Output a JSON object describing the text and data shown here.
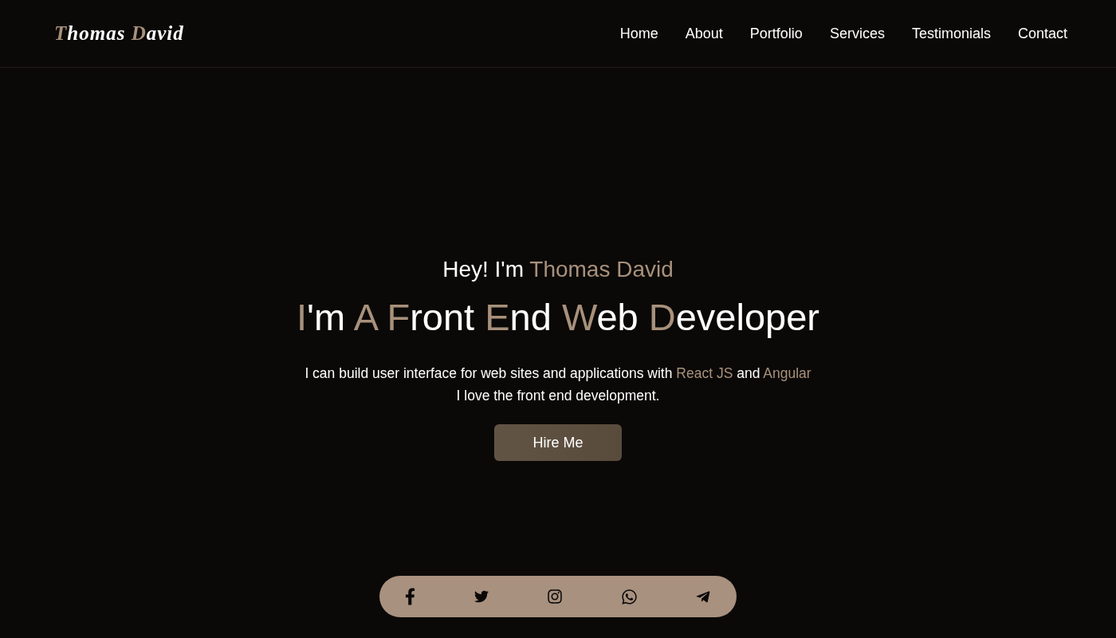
{
  "logo": {
    "segments": [
      {
        "text": "T",
        "accent": true
      },
      {
        "text": "homas ",
        "accent": false
      },
      {
        "text": "D",
        "accent": true
      },
      {
        "text": "avid",
        "accent": false
      }
    ]
  },
  "nav": {
    "items": [
      {
        "label": "Home"
      },
      {
        "label": "About"
      },
      {
        "label": "Portfolio"
      },
      {
        "label": "Services"
      },
      {
        "label": "Testimonials"
      },
      {
        "label": "Contact"
      }
    ]
  },
  "hero": {
    "greeting": {
      "segments": [
        {
          "text": "Hey! I'm ",
          "accent": false
        },
        {
          "text": "Thomas David",
          "accent": true
        }
      ]
    },
    "headline": {
      "segments": [
        {
          "text": "I",
          "accent": true
        },
        {
          "text": "'m ",
          "accent": false
        },
        {
          "text": "A ",
          "accent": true
        },
        {
          "text": "F",
          "accent": true
        },
        {
          "text": "ront ",
          "accent": false
        },
        {
          "text": "E",
          "accent": true
        },
        {
          "text": "nd ",
          "accent": false
        },
        {
          "text": "W",
          "accent": true
        },
        {
          "text": "eb ",
          "accent": false
        },
        {
          "text": "D",
          "accent": true
        },
        {
          "text": "eveloper",
          "accent": false
        }
      ]
    },
    "intro": {
      "lines": [
        {
          "segments": [
            {
              "text": "I can build user interface for web sites and applications with ",
              "accent": false
            },
            {
              "text": "React JS",
              "accent": true
            },
            {
              "text": " and ",
              "accent": false
            },
            {
              "text": "Angular",
              "accent": true
            }
          ]
        },
        {
          "segments": [
            {
              "text": "I love the front end development.",
              "accent": false
            }
          ]
        }
      ]
    },
    "button": {
      "label": "Hire Me"
    }
  },
  "social": {
    "items": [
      {
        "kind": "letter-f"
      },
      {
        "kind": "bird"
      },
      {
        "kind": "camera"
      },
      {
        "kind": "chat-phone"
      },
      {
        "kind": "paper-plane"
      }
    ]
  }
}
